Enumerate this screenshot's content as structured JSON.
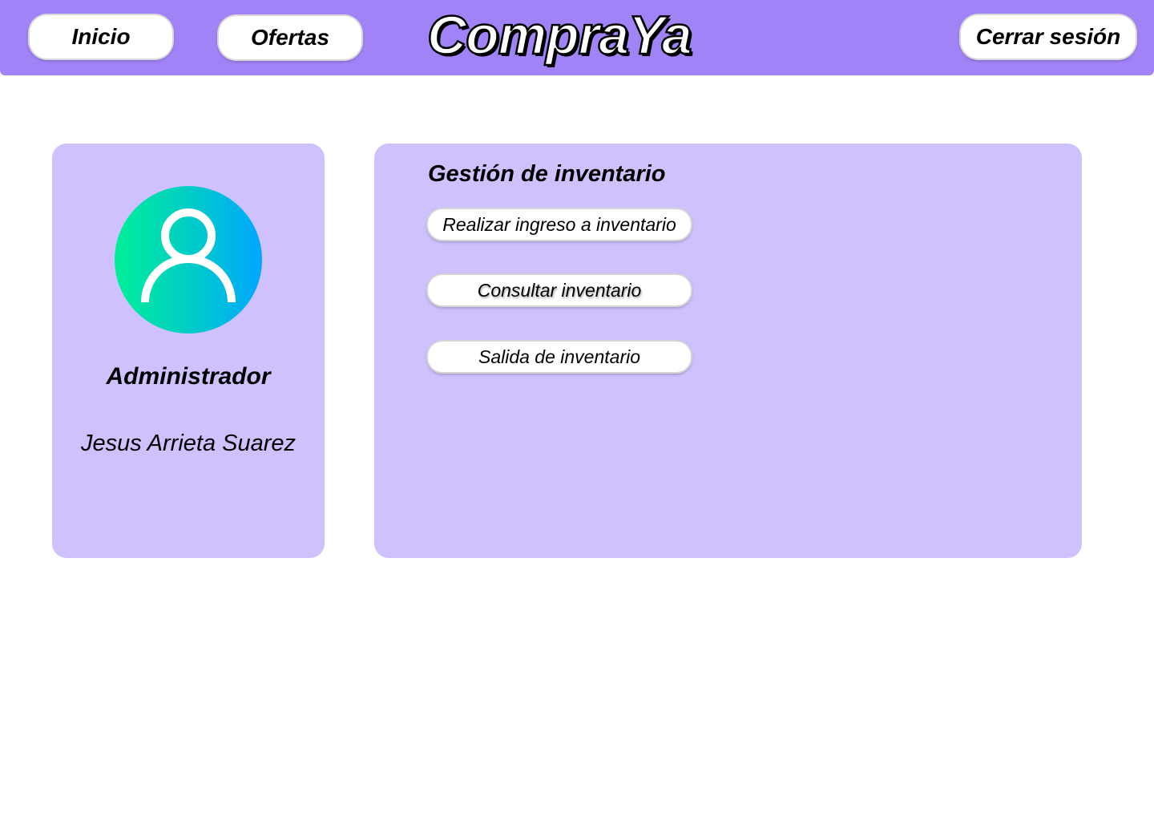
{
  "header": {
    "nav": {
      "inicio_label": "Inicio",
      "ofertas_label": "Ofertas"
    },
    "logo_text": "CompraYa",
    "logout_label": "Cerrar sesión",
    "background_color": "#a084f7"
  },
  "profile": {
    "avatar_icon": "user-icon",
    "role": "Administrador",
    "name": "Jesus Arrieta Suarez",
    "card_color": "#cfc1fe"
  },
  "inventory": {
    "title": "Gestión de inventario",
    "actions": [
      {
        "label": "Realizar ingreso a inventario"
      },
      {
        "label": "Consultar inventario"
      },
      {
        "label": "Salida de inventario"
      }
    ],
    "panel_color": "#cfc1fe"
  }
}
